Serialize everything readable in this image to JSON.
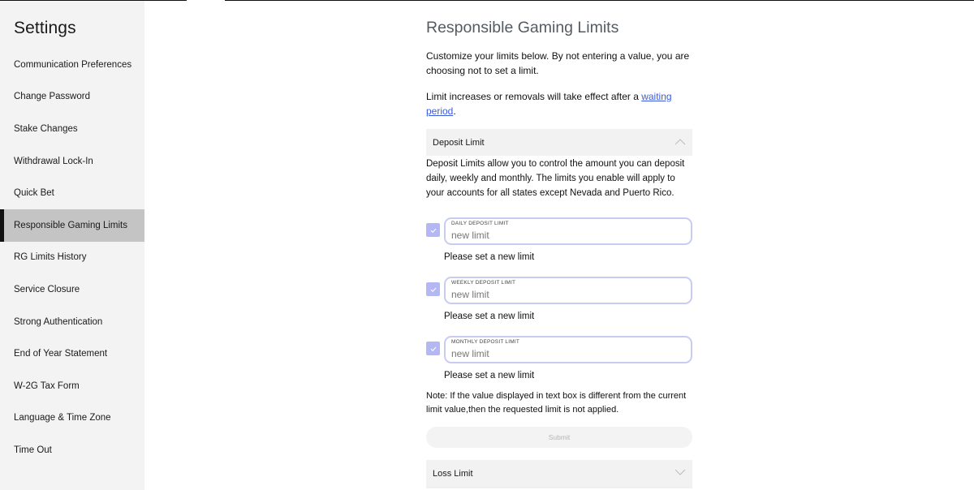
{
  "sidebar": {
    "title": "Settings",
    "items": [
      {
        "label": "Communication Preferences",
        "active": false
      },
      {
        "label": "Change Password",
        "active": false
      },
      {
        "label": "Stake Changes",
        "active": false
      },
      {
        "label": "Withdrawal Lock-In",
        "active": false
      },
      {
        "label": "Quick Bet",
        "active": false
      },
      {
        "label": "Responsible Gaming Limits",
        "active": true
      },
      {
        "label": "RG Limits History",
        "active": false
      },
      {
        "label": "Service Closure",
        "active": false
      },
      {
        "label": "Strong Authentication",
        "active": false
      },
      {
        "label": "End of Year Statement",
        "active": false
      },
      {
        "label": "W-2G Tax Form",
        "active": false
      },
      {
        "label": "Language & Time Zone",
        "active": false
      },
      {
        "label": "Time Out",
        "active": false
      }
    ]
  },
  "main": {
    "title": "Responsible Gaming Limits",
    "intro": "Customize your limits below. By not entering a value, you are choosing not to set a limit.",
    "waiting_text": "Limit increases or removals will take effect after a ",
    "waiting_link": "waiting period",
    "waiting_suffix": ".",
    "deposit_section": {
      "header": "Deposit Limit",
      "expanded": true,
      "chevron_icon": "chevron-up-icon",
      "description": "Deposit Limits allow you to control the amount you can deposit daily, weekly and monthly. The limits you enable will apply to your accounts for all states except Nevada and Puerto Rico.",
      "limits": [
        {
          "label": "DAILY DEPOSIT LIMIT",
          "placeholder": "new limit",
          "value": "",
          "checked": true,
          "hint": "Please set a new limit"
        },
        {
          "label": "WEEKLY DEPOSIT LIMIT",
          "placeholder": "new limit",
          "value": "",
          "checked": true,
          "hint": "Please set a new limit"
        },
        {
          "label": "MONTHLY DEPOSIT LIMIT",
          "placeholder": "new limit",
          "value": "",
          "checked": true,
          "hint": "Please set a new limit"
        }
      ],
      "note": "Note: If the value displayed in text box is different from the current limit value,then the requested limit is not applied.",
      "submit_label": "Submit"
    },
    "loss_section": {
      "header": "Loss Limit",
      "expanded": false,
      "chevron_icon": "chevron-down-icon"
    }
  },
  "colors": {
    "accent": "#b3b8f5",
    "input_border": "#c9ccf2",
    "link": "#3b5bdb",
    "sidebar_bg": "#f3f3f3",
    "active_bg": "#c4c4c4"
  }
}
